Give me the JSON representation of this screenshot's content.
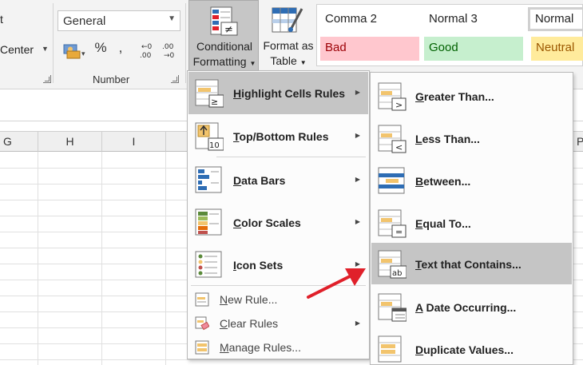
{
  "ribbon": {
    "truncated_left_top": "t",
    "truncated_center": "Center",
    "number_format": "General",
    "number_group_label": "Number",
    "conditional_formatting": {
      "line1": "Conditional",
      "line2": "Formatting"
    },
    "format_as_table": {
      "line1": "Format as",
      "line2": "Table"
    },
    "styles": [
      {
        "label": "Comma 2",
        "bg": "#ffffff",
        "fg": "#222222"
      },
      {
        "label": "Normal 3",
        "bg": "#ffffff",
        "fg": "#222222"
      },
      {
        "label": "Normal",
        "bg": "#ffffff",
        "fg": "#222222"
      },
      {
        "label": "Bad",
        "bg": "#ffc7ce",
        "fg": "#9c0006"
      },
      {
        "label": "Good",
        "bg": "#c6efce",
        "fg": "#006100"
      },
      {
        "label": "Neutral",
        "bg": "#ffeb9c",
        "fg": "#9c5700"
      }
    ]
  },
  "sheet": {
    "columns": [
      "G",
      "H",
      "I",
      "P"
    ]
  },
  "menu": {
    "items": [
      {
        "label": "Highlight Cells Rules",
        "icon": "highlight-cells-icon",
        "has_submenu": true,
        "selected": true
      },
      {
        "label": "Top/Bottom Rules",
        "icon": "top-bottom-icon",
        "has_submenu": true
      },
      {
        "label": "Data Bars",
        "icon": "data-bars-icon",
        "has_submenu": true
      },
      {
        "label": "Color Scales",
        "icon": "color-scales-icon",
        "has_submenu": true
      },
      {
        "label": "Icon Sets",
        "icon": "icon-sets-icon",
        "has_submenu": true
      }
    ],
    "small_items": [
      {
        "label": "New Rule...",
        "icon": "new-rule-icon",
        "has_submenu": false
      },
      {
        "label": "Clear Rules",
        "icon": "clear-rules-icon",
        "has_submenu": true
      },
      {
        "label": "Manage Rules...",
        "icon": "manage-rules-icon",
        "has_submenu": false
      }
    ]
  },
  "submenu": {
    "items": [
      {
        "label": "Greater Than...",
        "icon": "greater-than-icon"
      },
      {
        "label": "Less Than...",
        "icon": "less-than-icon"
      },
      {
        "label": "Between...",
        "icon": "between-icon"
      },
      {
        "label": "Equal To...",
        "icon": "equal-to-icon"
      },
      {
        "label": "Text that Contains...",
        "icon": "text-contains-icon",
        "selected": true
      },
      {
        "label": "A Date Occurring...",
        "icon": "date-occurring-icon"
      },
      {
        "label": "Duplicate Values...",
        "icon": "duplicate-values-icon"
      }
    ]
  },
  "colors": {
    "selection": "#c5c5c5",
    "arrow": "#e0202a",
    "cell_yellow": "#f2c46d",
    "cell_blue": "#2e6db4"
  }
}
